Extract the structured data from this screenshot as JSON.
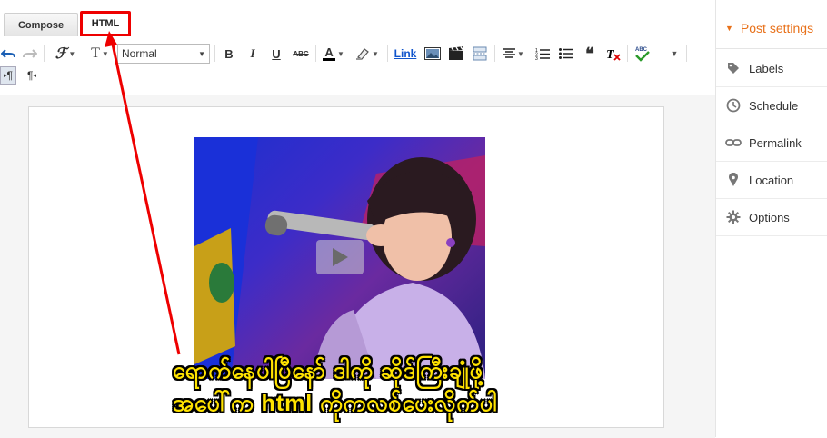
{
  "tabs": {
    "compose": "Compose",
    "html": "HTML"
  },
  "toolbar": {
    "font_size_glyph": "T",
    "font_select_value": "Normal",
    "bold": "B",
    "italic": "I",
    "underline": "U",
    "strike": "ABC",
    "text_color": "A",
    "link": "Link",
    "ltr": "¶",
    "rtl": "¶"
  },
  "caption": {
    "line1": "ရောက်နေပါပြီနော် ဒါကို ဆိုဒ်ကြီးချုံဖို့",
    "line2": "အပေါ်က html ကိုကလစ်ပေးလိုက်ပါ"
  },
  "sidebar": {
    "title": "Post settings",
    "items": [
      {
        "label": "Labels",
        "icon": "tag-icon"
      },
      {
        "label": "Schedule",
        "icon": "clock-icon"
      },
      {
        "label": "Permalink",
        "icon": "link-icon"
      },
      {
        "label": "Location",
        "icon": "pin-icon"
      },
      {
        "label": "Options",
        "icon": "gear-icon"
      }
    ]
  },
  "colors": {
    "accent": "#e8711a",
    "annotation": "#ee0000",
    "caption": "#ffe300",
    "link": "#1155cc"
  }
}
